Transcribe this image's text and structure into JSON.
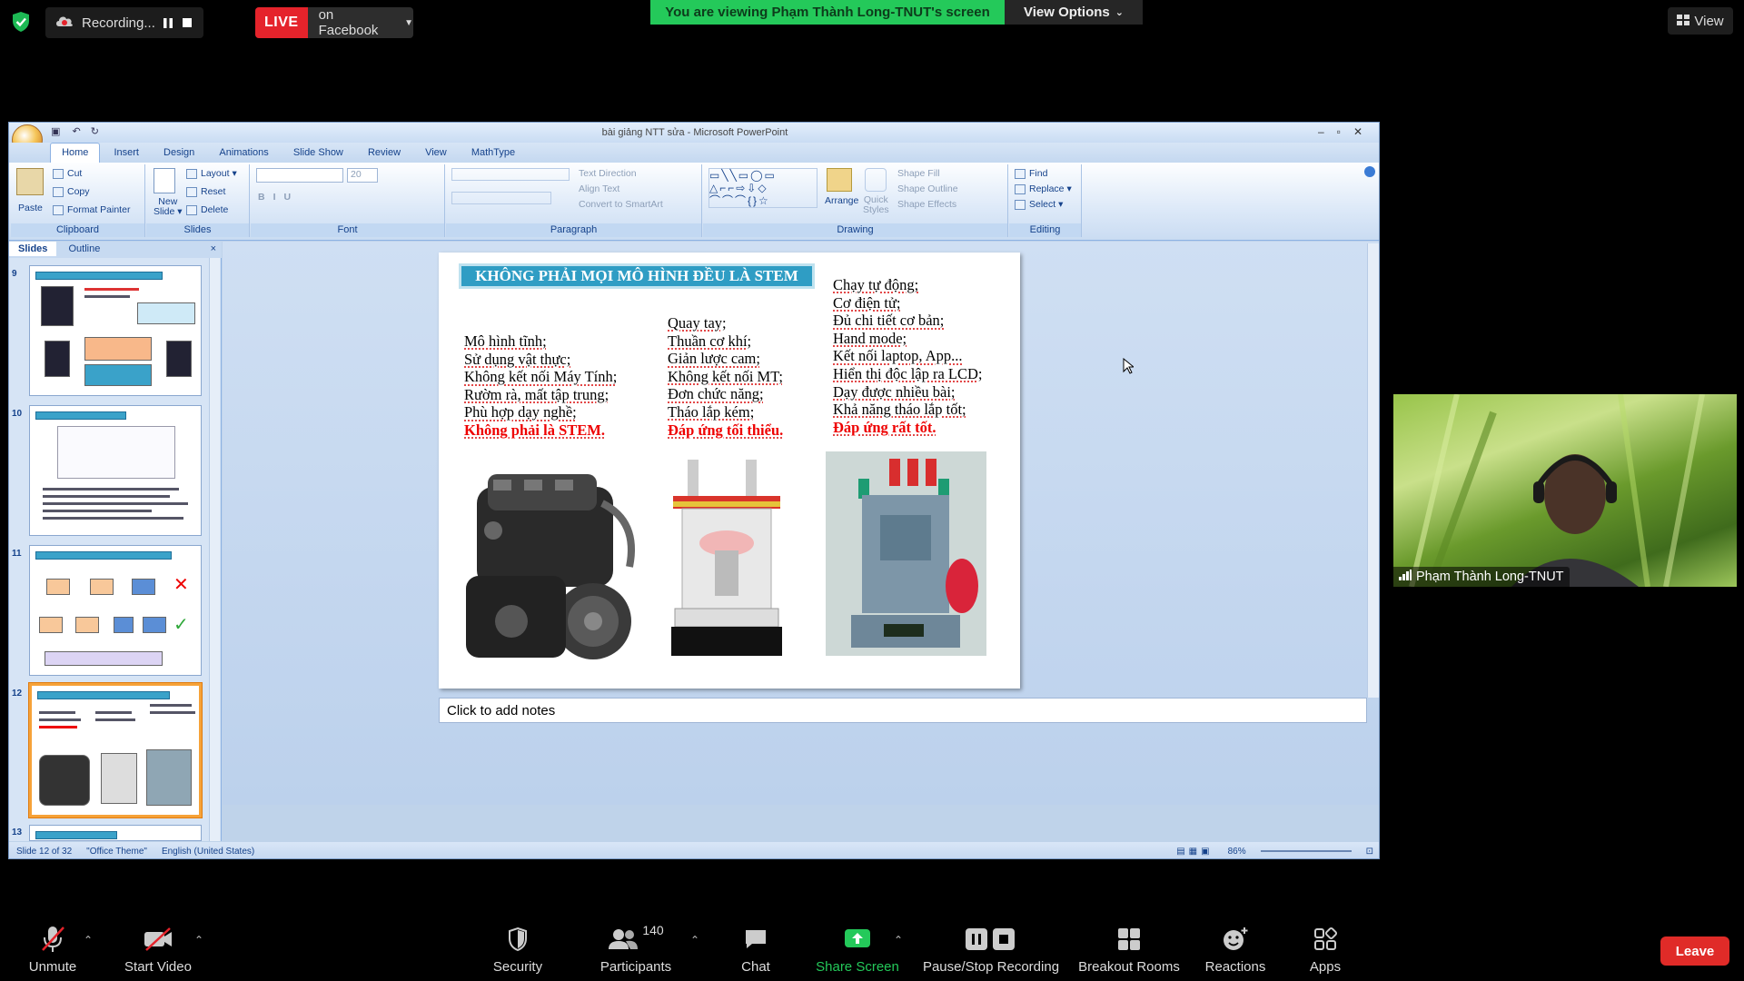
{
  "top": {
    "recording_label": "Recording...",
    "live_tag": "LIVE",
    "live_target": "on Facebook",
    "viewing_banner": "You are viewing Phạm Thành Long-TNUT's screen",
    "view_options": "View Options",
    "view_button": "View"
  },
  "ppt": {
    "window_title": "bài giảng NTT sửa - Microsoft PowerPoint",
    "tabs": [
      "Home",
      "Insert",
      "Design",
      "Animations",
      "Slide Show",
      "Review",
      "View",
      "MathType"
    ],
    "ribbon": {
      "clipboard": {
        "label": "Clipboard",
        "paste": "Paste",
        "cut": "Cut",
        "copy": "Copy",
        "format_painter": "Format Painter"
      },
      "slides": {
        "label": "Slides",
        "new_slide_1": "New",
        "new_slide_2": "Slide",
        "layout": "Layout",
        "reset": "Reset",
        "delete": "Delete"
      },
      "font": {
        "label": "Font",
        "size": "20"
      },
      "paragraph": {
        "label": "Paragraph",
        "text_direction": "Text Direction",
        "align_text": "Align Text",
        "convert_smartart": "Convert to SmartArt"
      },
      "drawing": {
        "label": "Drawing",
        "arrange": "Arrange",
        "quick_1": "Quick",
        "quick_2": "Styles",
        "shape_fill": "Shape Fill",
        "shape_outline": "Shape Outline",
        "shape_effects": "Shape Effects"
      },
      "editing": {
        "label": "Editing",
        "find": "Find",
        "replace": "Replace",
        "select": "Select"
      }
    },
    "panel_tabs": {
      "slides": "Slides",
      "outline": "Outline"
    },
    "thumb_numbers": [
      "9",
      "10",
      "11",
      "12",
      "13"
    ],
    "slide": {
      "title": "KHÔNG PHẢI MỌI MÔ HÌNH ĐỀU LÀ STEM",
      "col1": [
        "Mô hình tĩnh;",
        "Sử dụng vật thực;",
        "Không kết nối Máy Tính;",
        "Rườm rà, mất tập trung;",
        "Phù hợp dạy nghề;"
      ],
      "col1_red": "Không phải là STEM.",
      "col2": [
        "Quay tay;",
        "Thuần cơ khí;",
        "Giản lược cam;",
        "Không kết nối MT;",
        "Đơn chức năng;",
        "Tháo lắp kém;"
      ],
      "col2_red": "Đáp ứng tối thiểu.",
      "col3": [
        "Chạy tự động;",
        "Cơ điện tử;",
        "Đủ chi tiết cơ bản;",
        "Hand mode;",
        "Kết nối laptop, App...",
        "Hiển thị độc lập ra LCD;",
        "Dạy được nhiều bài;",
        "Khả năng tháo lắp tốt;"
      ],
      "col3_red": "Đáp ứng rất tốt."
    },
    "notes_placeholder": "Click to add notes",
    "status": {
      "slide_info": "Slide 12 of 32",
      "theme": "\"Office Theme\"",
      "language": "English (United States)",
      "zoom": "86%"
    }
  },
  "participant": {
    "name": "Phạm Thành Long-TNUT"
  },
  "toolbar": {
    "unmute": "Unmute",
    "start_video": "Start Video",
    "security": "Security",
    "participants": "Participants",
    "participants_count": "140",
    "chat": "Chat",
    "share_screen": "Share Screen",
    "pause_stop_recording": "Pause/Stop Recording",
    "breakout_rooms": "Breakout Rooms",
    "reactions": "Reactions",
    "apps": "Apps",
    "leave": "Leave"
  },
  "colors": {
    "share_green": "#24c95a",
    "live_red": "#e5232b",
    "leave_red": "#e02b28",
    "slide_title_blue": "#2f9dc4",
    "accent_red": "#ee0000"
  }
}
